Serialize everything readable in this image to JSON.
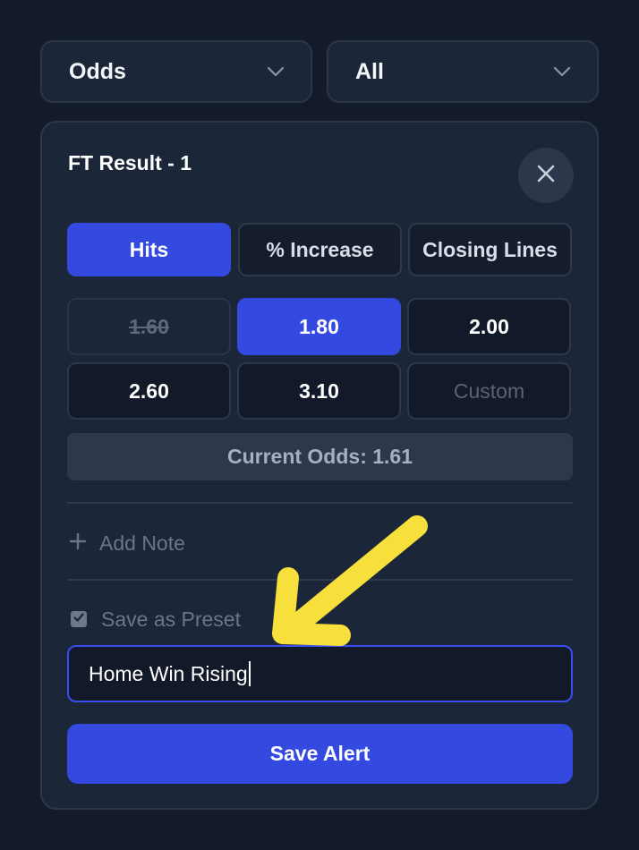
{
  "selects": {
    "market": {
      "value": "Odds",
      "icon": "chevron-down-icon"
    },
    "filter": {
      "value": "All",
      "icon": "chevron-down-icon"
    }
  },
  "card": {
    "title": "FT Result - 1",
    "close_icon": "close-icon",
    "tabs": [
      {
        "label": "Hits",
        "active": true
      },
      {
        "label": "% Increase",
        "active": false
      },
      {
        "label": "Closing Lines",
        "active": false
      }
    ],
    "odds_options": [
      {
        "label": "1.60",
        "state": "disabled"
      },
      {
        "label": "1.80",
        "state": "selected"
      },
      {
        "label": "2.00",
        "state": "normal"
      },
      {
        "label": "2.60",
        "state": "normal"
      },
      {
        "label": "3.10",
        "state": "normal"
      },
      {
        "label": "Custom",
        "state": "placeholder"
      }
    ],
    "current_odds": "Current Odds: 1.61",
    "add_note": {
      "label": "Add Note",
      "icon": "plus-icon"
    },
    "save_preset": {
      "label": "Save as Preset",
      "checked": true
    },
    "preset_name": {
      "value": "Home Win Rising"
    },
    "save_button": "Save Alert"
  },
  "colors": {
    "background": "#131b2b",
    "card": "#1c2639",
    "accent": "#3349e0",
    "annotation_arrow": "#f7e03c"
  },
  "annotation": {
    "icon": "arrow-annotation-icon"
  }
}
